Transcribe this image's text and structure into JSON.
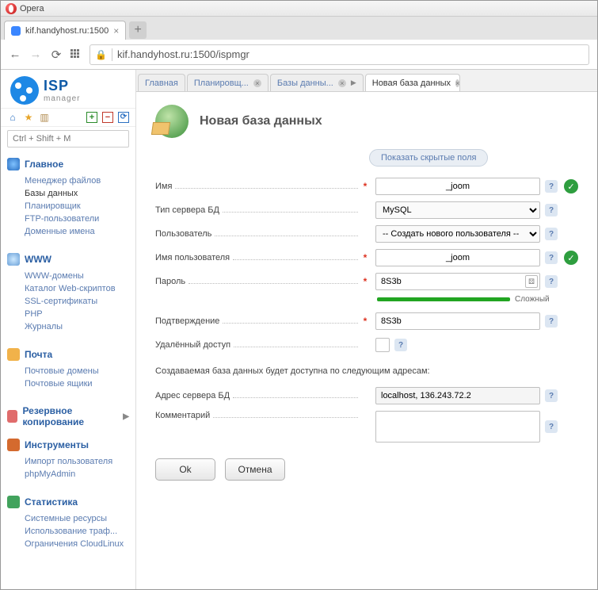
{
  "window": {
    "app": "Opera"
  },
  "browser_tab": {
    "title": "kif.handyhost.ru:1500"
  },
  "url": "kif.handyhost.ru:1500/ispmgr",
  "logo": {
    "line1": "ISP",
    "line2": "manager"
  },
  "sidebar_search_placeholder": "Ctrl + Shift + M",
  "nav": [
    {
      "title": "Главное",
      "icon": "ico-globe",
      "items": [
        "Менеджер файлов",
        "Базы данных",
        "Планировщик",
        "FTP-пользователи",
        "Доменные имена"
      ],
      "active_index": 1
    },
    {
      "title": "WWW",
      "icon": "ico-www",
      "items": [
        "WWW-домены",
        "Каталог Web-скриптов",
        "SSL-сертификаты",
        "PHP",
        "Журналы"
      ]
    },
    {
      "title": "Почта",
      "icon": "ico-mail",
      "items": [
        "Почтовые домены",
        "Почтовые ящики"
      ]
    },
    {
      "title": "Резервное копирование",
      "icon": "ico-backup",
      "collapsed": true
    },
    {
      "title": "Инструменты",
      "icon": "ico-tools",
      "items": [
        "Импорт пользователя",
        "phpMyAdmin"
      ]
    },
    {
      "title": "Статистика",
      "icon": "ico-stats",
      "items": [
        "Системные ресурсы",
        "Использование траф...",
        "Ограничения CloudLinux"
      ]
    }
  ],
  "tabs": [
    {
      "label": "Главная",
      "closable": false
    },
    {
      "label": "Планировщ...",
      "closable": true
    },
    {
      "label": "Базы данны...",
      "closable": true,
      "chevron": true
    },
    {
      "label": "Новая база данных",
      "closable": true,
      "active": true
    }
  ],
  "page_title": "Новая база данных",
  "hidden_fields_btn": "Показать скрытые поля",
  "form": {
    "name": {
      "label": "Имя",
      "value": "_joom",
      "required": true,
      "valid": true
    },
    "server_type": {
      "label": "Тип сервера БД",
      "value": "MySQL"
    },
    "user": {
      "label": "Пользователь",
      "value": "-- Создать нового пользователя --"
    },
    "username": {
      "label": "Имя пользователя",
      "value": "_joom",
      "required": true,
      "valid": true
    },
    "password": {
      "label": "Пароль",
      "value": "8S3b",
      "required": true
    },
    "strength": "Сложный",
    "confirm": {
      "label": "Подтверждение",
      "value": "8S3b",
      "required": true
    },
    "remote": {
      "label": "Удалённый доступ"
    },
    "info": "Создаваемая база данных будет доступна по следующим адресам:",
    "server_addr": {
      "label": "Адрес сервера БД",
      "value": "localhost, 136.243.72.2"
    },
    "comment": {
      "label": "Комментарий"
    }
  },
  "buttons": {
    "ok": "Ok",
    "cancel": "Отмена"
  }
}
